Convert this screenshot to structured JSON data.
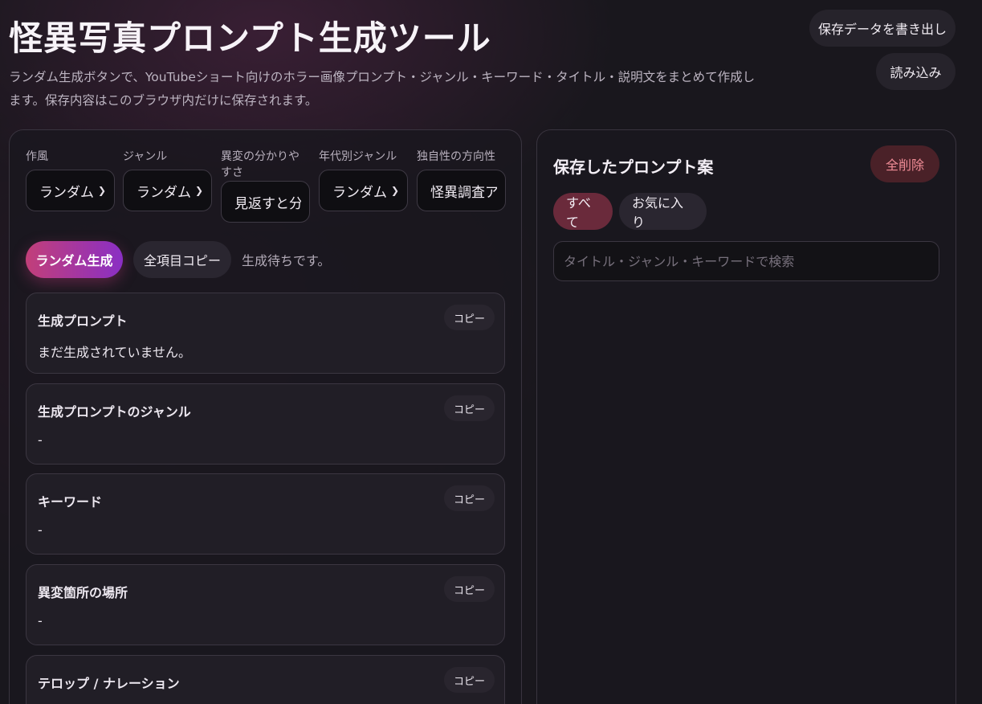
{
  "header": {
    "title": "怪異写真プロンプト生成ツール",
    "description": "ランダム生成ボタンで、YouTubeショート向けのホラー画像プロンプト・ジャンル・キーワード・タイトル・説明文をまとめて作成します。保存内容はこのブラウザ内だけに保存されます。",
    "export_label": "保存データを書き出し",
    "import_label": "読み込み"
  },
  "controls": {
    "fields": [
      {
        "label": "作風",
        "value": "ランダム"
      },
      {
        "label": "ジャンル",
        "value": "ランダム"
      },
      {
        "label": "異変の分かりやすさ",
        "value": "見返すと分"
      },
      {
        "label": "年代別ジャンル",
        "value": "ランダム"
      },
      {
        "label": "独自性の方向性",
        "value": "怪異調査ア"
      }
    ],
    "random_label": "ランダム生成",
    "copy_all_label": "全項目コピー",
    "status": "生成待ちです。"
  },
  "results": [
    {
      "title": "生成プロンプト",
      "body": "まだ生成されていません。",
      "copy": "コピー"
    },
    {
      "title": "生成プロンプトのジャンル",
      "body": "-",
      "copy": "コピー"
    },
    {
      "title": "キーワード",
      "body": "-",
      "copy": "コピー"
    },
    {
      "title": "異変箇所の場所",
      "body": "-",
      "copy": "コピー"
    },
    {
      "title": "テロップ / ナレーション",
      "body": "",
      "copy": "コピー"
    }
  ],
  "saved": {
    "title": "保存したプロンプト案",
    "clear_label": "全削除",
    "tabs": [
      "すべて",
      "お気に入り"
    ],
    "search_placeholder": "タイトル・ジャンル・キーワードで検索"
  },
  "colors": {
    "accent_gradient_start": "#c23f79",
    "accent_gradient_end": "#8a2fc4",
    "danger": "#f08c96",
    "background": "#19171d"
  }
}
